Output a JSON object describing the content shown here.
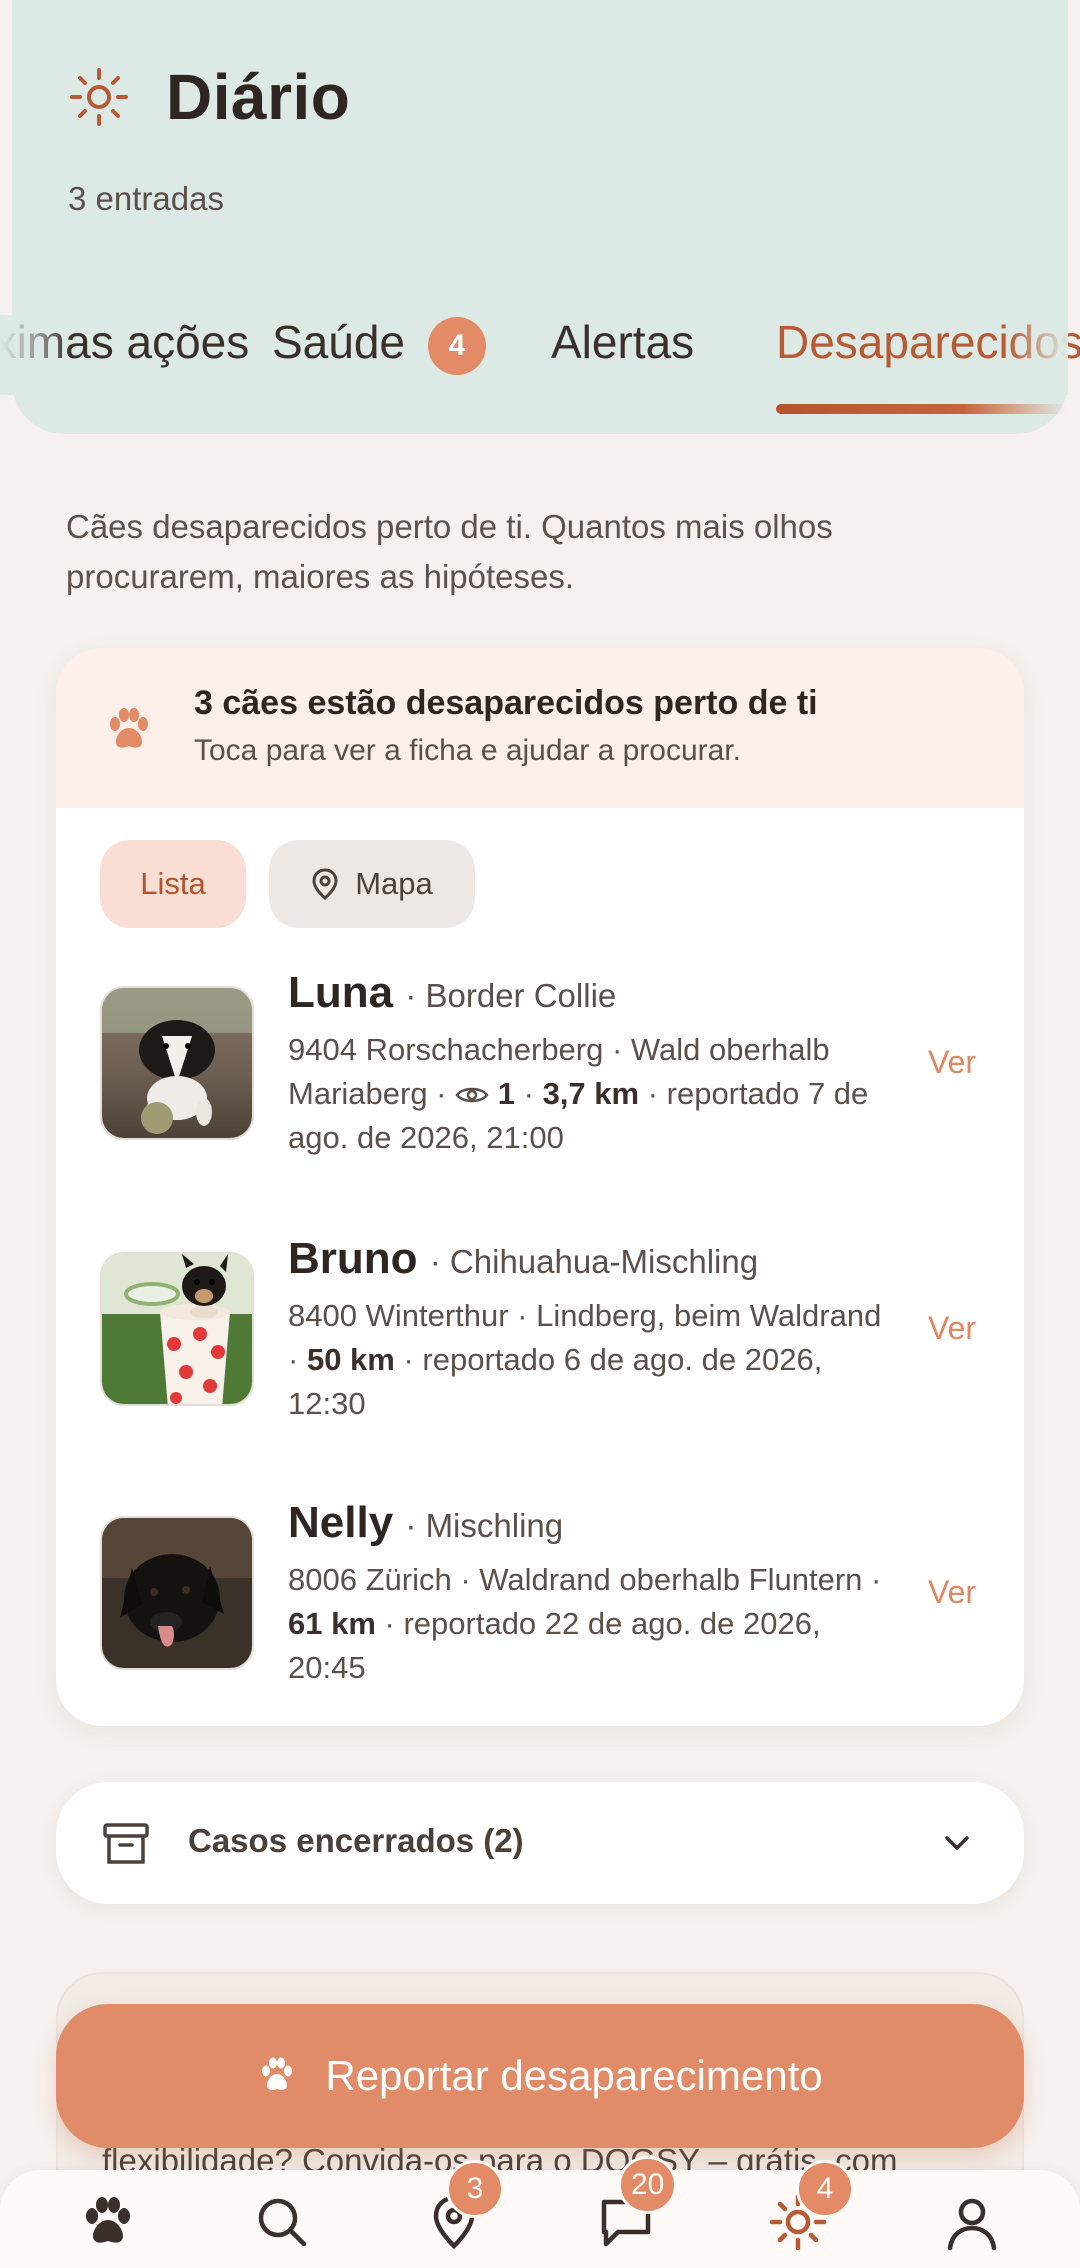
{
  "header": {
    "title": "Diário",
    "subtitle": "3 entradas"
  },
  "tabs": [
    {
      "label": "Próximas ações"
    },
    {
      "label": "Saúde",
      "badge": "4"
    },
    {
      "label": "Alertas"
    },
    {
      "label": "Desaparecidos",
      "active": true
    }
  ],
  "intro": "Cães desaparecidos perto de ti. Quantos mais olhos procurarem, maiores as hipóteses.",
  "banner": {
    "title": "3 cães estão desaparecidos perto de ti",
    "subtitle": "Toca para ver a ficha e ajudar a procurar."
  },
  "view_toggle": {
    "list_label": "Lista",
    "map_label": "Mapa",
    "selected": "Lista"
  },
  "dogs": [
    {
      "name": "Luna",
      "breed": "· Border Collie",
      "location": "9404 Rorschacherberg · Wald oberhalb Mariaberg ·",
      "views": "1",
      "distance": "3,7 km",
      "reported": "· reportado 7 de ago. de 2026, 21:00",
      "action": "Ver"
    },
    {
      "name": "Bruno",
      "breed": "· Chihuahua-Mischling",
      "location": "8400 Winterthur · Lindberg, beim Waldrand ·",
      "distance": "50 km",
      "reported": "· reportado 6 de ago. de 2026, 12:30",
      "action": "Ver"
    },
    {
      "name": "Nelly",
      "breed": "· Mischling",
      "location": "8006 Zürich · Waldrand oberhalb Fluntern ·",
      "distance": "61 km",
      "reported": "· reportado 22 de ago. de 2026, 20:45",
      "action": "Ver"
    }
  ],
  "closed_cases": {
    "label": "Casos encerrados (2)"
  },
  "report_button": {
    "label": "Reportar desaparecimento"
  },
  "underlying_text": "flexibilidade? Convida-os para o DOGSY – grátis, com",
  "bottom_nav": {
    "items": [
      {
        "icon": "paw-icon"
      },
      {
        "icon": "search-icon"
      },
      {
        "icon": "location-pin-icon",
        "badge": "3"
      },
      {
        "icon": "chat-icon",
        "badge": "20"
      },
      {
        "icon": "sun-icon",
        "badge": "4",
        "active": true
      },
      {
        "icon": "profile-icon"
      }
    ]
  },
  "colors": {
    "accent": "#e08c69",
    "accent_dark": "#b85a34",
    "header_bg": "#dde9e4",
    "banner_bg": "#fcefe9"
  }
}
